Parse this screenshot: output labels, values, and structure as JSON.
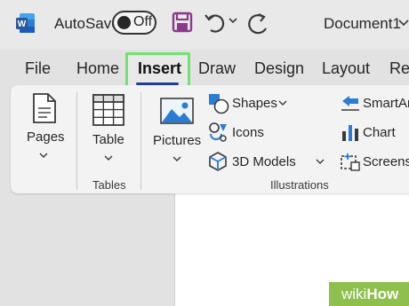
{
  "titlebar": {
    "autosave_label": "AutoSave",
    "autosave_state": "Off",
    "document_title": "Document1"
  },
  "tabs": [
    {
      "label": "File"
    },
    {
      "label": "Home"
    },
    {
      "label": "Insert",
      "selected": true
    },
    {
      "label": "Draw"
    },
    {
      "label": "Design"
    },
    {
      "label": "Layout"
    },
    {
      "label": "Re"
    }
  ],
  "ribbon": {
    "pages": {
      "label": "Pages"
    },
    "tables": {
      "button_label": "Table",
      "group_label": "Tables"
    },
    "illustrations": {
      "pictures_label": "Pictures",
      "shapes_label": "Shapes",
      "icons_label": "Icons",
      "models_label": "3D Models",
      "smartart_label": "SmartAr",
      "chart_label": "Chart",
      "screenshot_label": "Screens",
      "group_label": "Illustrations"
    }
  },
  "watermark": {
    "part1": "wiki",
    "part2": "How"
  },
  "colors": {
    "word_blue": "#2b579a",
    "highlight_green": "#6ee36e",
    "save_purple": "#8a3a8c",
    "tab_underline": "#1f3f8f"
  }
}
